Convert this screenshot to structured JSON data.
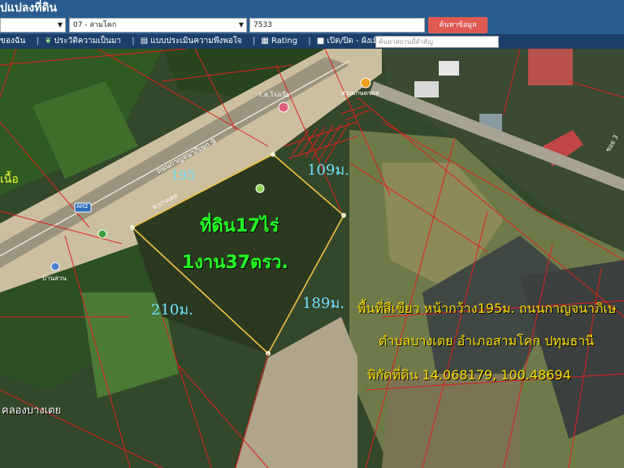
{
  "header": {
    "title": "ปแปลงที่ดิน"
  },
  "controls": {
    "province_value": "",
    "district_value": "07 - สามโคก",
    "parcel_value": "7533",
    "search_button": "ค้นหาข้อมูล"
  },
  "toolbar": {
    "items": [
      "ของฉัน",
      "ประวัติความเป็นมา",
      "แบบประเมินความพึงพอใจ",
      "Rating",
      "เปิด/ปิด - ผังเมือง"
    ],
    "place_placeholder": "ค้นหาสถานที่สำคัญ"
  },
  "map": {
    "labels": {
      "area_line1": "ที่ดิน17ไร่",
      "area_line2": "1งาน37ตรว.",
      "dim_top": "109ม.",
      "dim_left": "195",
      "dim_right": "189ม.",
      "dim_bottom": "210ม.",
      "desc_line1": "พื้นที่สีเขียว หน้ากว้าง195ม. ถนนกาญจนาภิเษ",
      "desc_line2": "ตำบลบางเตย อำเภอสามโคก ปทุมธานี",
      "desc_line3": "พิกัดที่ดิน 14.068179, 100.48694",
      "canal_label": "คลองบางเตย",
      "road_label": "ถนนกาญจนาภิเษก 9",
      "road_label_small": "ต.บางเตย",
      "side_label": "เนื้อ",
      "poi1": "ร.ส.โรงเรีย",
      "poi2": "สวนเกษตรผล",
      "poi3": "บ้านสวน",
      "highway_shield": "AH2",
      "street_right": "ซอย 3"
    }
  },
  "colors": {
    "header": "#2a5d8f",
    "toolbar": "#1b3f68",
    "search_button": "#e05a52",
    "parcel_line": "#e02020",
    "plot_outline": "#f0c040",
    "label_green": "#22ff22",
    "label_cyan": "#6fe0ff",
    "label_yellow": "#ffe000"
  }
}
